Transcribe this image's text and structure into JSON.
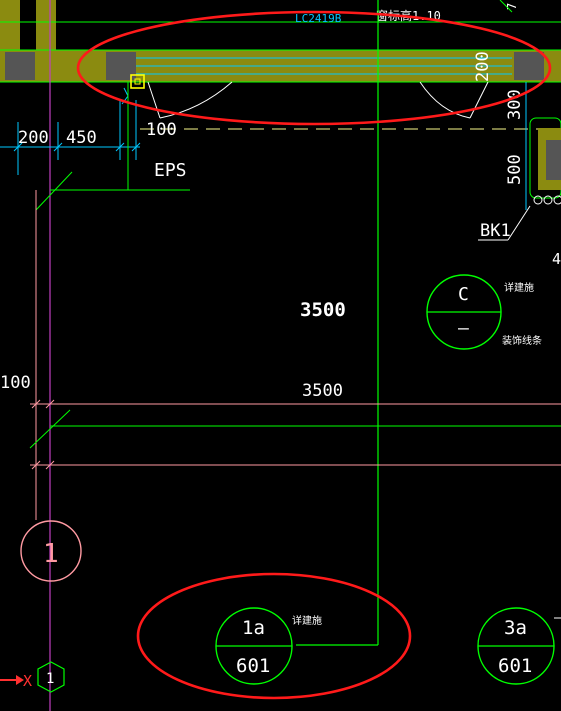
{
  "drawing": {
    "top_labels": {
      "window_code": "LC2419B",
      "elevation_note": "窗标高1.10"
    },
    "dims": {
      "d200_top": "200",
      "d300": "300",
      "d500": "500",
      "d200_left": "200",
      "d450": "450",
      "d100_top": "100",
      "d3500_bold": "3500",
      "d3500_line": "3500",
      "d100_left": "100",
      "d4_partial": "4",
      "d7_partial": "7"
    },
    "labels": {
      "eps": "EPS",
      "bk1": "BK1"
    },
    "callouts": {
      "c": {
        "top": "C",
        "bottom": "–",
        "note1": "详建施",
        "note2": "装饰线条"
      },
      "c1a": {
        "top": "1a",
        "bottom": "601",
        "note": "详建施"
      },
      "c3a": {
        "top": "3a",
        "bottom": "601"
      },
      "axis_grid": {
        "label": "1"
      }
    },
    "ucs": {
      "x": "X",
      "origin_label": "1"
    },
    "colors": {
      "wall_fill": "#8b8b10",
      "green": "#00ff00",
      "cyan": "#00c8ff",
      "pink": "#ff9aa2",
      "magenta": "#c040c0",
      "red_ellipse": "#ff1a1a",
      "white": "#ffffff"
    }
  }
}
